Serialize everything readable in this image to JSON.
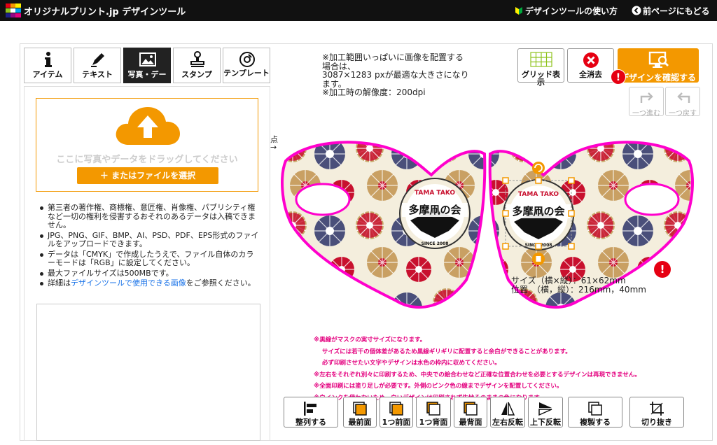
{
  "header": {
    "brand": "オリジナルプリント.jp デザインツール",
    "guide_link": "デザインツールの使い方",
    "back_link": "前ページにもどる"
  },
  "tabs": [
    {
      "label": "アイテム",
      "icon": "info-icon",
      "active": false
    },
    {
      "label": "テキスト",
      "icon": "pen-icon",
      "active": false
    },
    {
      "label": "写真・デー",
      "icon": "image-icon",
      "active": true
    },
    {
      "label": "スタンプ",
      "icon": "stamp-icon",
      "active": false
    },
    {
      "label": "テンプレート",
      "icon": "template-icon",
      "active": false
    }
  ],
  "upload": {
    "drop_text": "ここに写真やデータをドラッグしてください",
    "file_button": "＋ またはファイルを選択"
  },
  "notes": {
    "n1": "第三者の著作権、商標権、意匠権、肖像権、パブリシティ権など一切の権利を侵害するおそれのあるデータは入稿できません。",
    "n2": "JPG、PNG、GIF、BMP、AI、PSD、PDF、EPS形式のファイルをアップロードできます。",
    "n3": "データは「CMYK」で作成したうえで、ファイル自体のカラーモードは「RGB」に設定してください。",
    "n4": "最大ファイルサイズは500MBです。",
    "n5_prefix": "詳細は",
    "n5_link": "デザインツールで使用できる画像",
    "n5_suffix": "をご参照ください。"
  },
  "info": {
    "line1": "※加工範囲いっぱいに画像を配置する",
    "line2": "場合は、",
    "line3": "3087×1283 pxが最適な大きさになり",
    "line4": "ます。",
    "line5": "※加工時の解像度：200dpi"
  },
  "origin_label_1": "点",
  "origin_label_2": "→",
  "top_buttons": {
    "grid": "グリッド表示",
    "clear": "全消去",
    "confirm": "デザインを確認する",
    "redo": "一つ進む",
    "undo": "一つ戻す",
    "alert": "!"
  },
  "selection": {
    "size_label": "サイズ（横×縦）",
    "size_value": "：61×62mm",
    "pos_label": "位置　（横，縦）",
    "pos_value": "：216mm，40mm"
  },
  "design": {
    "top_text": "TAMA TAKO",
    "main_text": "多摩凧の会",
    "since_text": "SINCE 2008"
  },
  "pink_notes": [
    "※黒線がマスクの実寸サイズになります。",
    "サイズには若干の個体差があるため黒線ギリギリに配置すると余白ができることがあります。",
    "必ず印刷させたい文字やデザインは水色の枠内に収めてください。",
    "※左右をそれぞれ別々に印刷するため、中央での絵合わせなど正確な位置合わせを必要とするデザインは再現できません。",
    "※全面印刷には塗り足しが必要です。外側のピンク色の線までデザインを配置してください。",
    "※白インクを使わないため、白いデザインは印刷されず生地そのままの色になります。"
  ],
  "bottom_buttons": {
    "align": "整列する",
    "front": "最前面",
    "forward": "1つ前面",
    "backward": "1つ背面",
    "back": "最背面",
    "flip_h": "左右反転",
    "flip_v": "上下反転",
    "duplicate": "複製する",
    "crop": "切り抜き"
  },
  "colors": {
    "accent": "#f39800",
    "alert": "#e60012",
    "pink_guide": "#e4007f",
    "link": "#1a73e8"
  }
}
